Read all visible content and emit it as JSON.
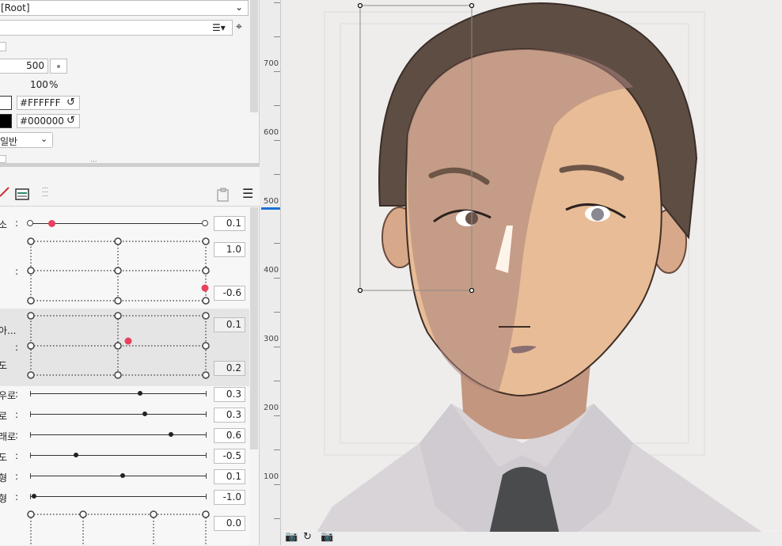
{
  "properties": {
    "parent_select": "[Root]",
    "number_value": "500",
    "percent_value": "100",
    "percent_unit": "%",
    "color_1": "#FFFFFF",
    "color_2": "#000000",
    "blend_mode": "일반",
    "swatch_1": "#ffffff",
    "swatch_2": "#000000"
  },
  "params": {
    "rows": [
      {
        "label": "소",
        "value": "0.1"
      },
      {
        "label": "",
        "value": "1.0"
      },
      {
        "label": "",
        "value": "-0.6"
      },
      {
        "label": "아...",
        "value": "0.1"
      },
      {
        "label": "도",
        "value": "0.2"
      },
      {
        "label": "우로",
        "value": "0.3"
      },
      {
        "label": "로",
        "value": "0.3"
      },
      {
        "label": "래로",
        "value": "0.6"
      },
      {
        "label": "도",
        "value": "-0.5"
      },
      {
        "label": "형",
        "value": "0.1"
      },
      {
        "label": "형",
        "value": "-1.0"
      },
      {
        "label": "",
        "value": "0.0"
      }
    ],
    "colon": ":"
  },
  "ruler": {
    "ticks": [
      "700",
      "600",
      "500",
      "400",
      "300",
      "200",
      "100"
    ]
  },
  "colors": {
    "accent": "#e8405e",
    "ruler_marker": "#1e6fd6"
  }
}
